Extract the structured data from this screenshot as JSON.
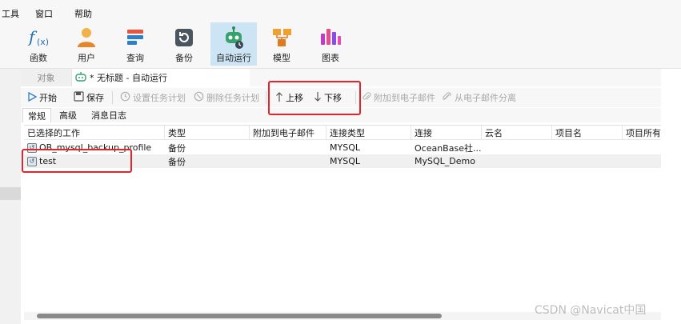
{
  "menu": {
    "items": [
      "工具",
      "窗口",
      "帮助"
    ]
  },
  "ribbon": {
    "buttons": [
      {
        "label": "函数",
        "icon": "function-icon"
      },
      {
        "label": "用户",
        "icon": "user-icon"
      },
      {
        "label": "查询",
        "icon": "query-icon"
      },
      {
        "label": "备份",
        "icon": "backup-icon"
      },
      {
        "label": "自动运行",
        "icon": "robot-icon",
        "active": true
      },
      {
        "label": "模型",
        "icon": "model-icon"
      },
      {
        "label": "图表",
        "icon": "chart-icon"
      }
    ]
  },
  "tabs": {
    "object_label": "对象",
    "doc_title": "* 无标题 - 自动运行"
  },
  "actions": {
    "start": "开始",
    "save": "保存",
    "set_schedule": "设置任务计划",
    "delete_schedule": "删除任务计划",
    "move_up": "上移",
    "move_down": "下移",
    "attach_email": "附加到电子邮件",
    "detach_email": "从电子邮件分离"
  },
  "subtabs": [
    "常规",
    "高级",
    "消息日志"
  ],
  "grid": {
    "headers": [
      "已选择的工作",
      "类型",
      "附加到电子邮件",
      "连接类型",
      "连接",
      "云名",
      "项目名",
      "项目所有"
    ],
    "rows": [
      {
        "job": "OB_mysql_backup_profile",
        "type": "备份",
        "email": "",
        "conn_type": "MYSQL",
        "conn": "OceanBase社...",
        "cloud": "",
        "project": "",
        "owner": ""
      },
      {
        "job": "test",
        "type": "备份",
        "email": "",
        "conn_type": "MYSQL",
        "conn": "MySQL_Demo",
        "cloud": "",
        "project": "",
        "owner": ""
      }
    ]
  },
  "watermark": "CSDN @Navicat中国",
  "colors": {
    "highlight": "#e3242b",
    "active_tab": "#cde4f5"
  }
}
